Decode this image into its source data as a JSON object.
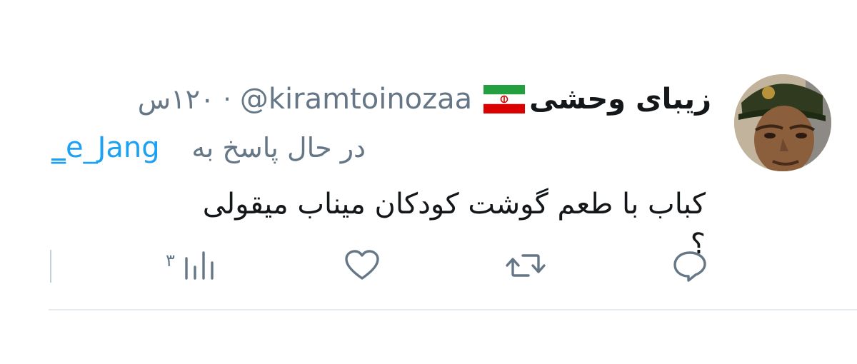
{
  "tweet": {
    "display_name": "زیبای وحشی",
    "flag": "iran-flag-icon",
    "handle": "@kiramtoinozaa",
    "separator": "·",
    "timestamp": "۱۲۰س",
    "reply_label": "در حال پاسخ به",
    "reply_to": "e_Jang",
    "reply_to_prefix": "_",
    "text_lines": [
      "کباب با طعم گوشت کودکان میناب میقولی",
      "؟"
    ]
  },
  "actions": {
    "views_count": "۳",
    "icons": [
      "reply-icon",
      "retweet-icon",
      "like-icon",
      "views-icon"
    ]
  },
  "colors": {
    "text": "#14171a",
    "secondary": "#657786",
    "link": "#1da1f2",
    "divider": "#e6ecf0",
    "flag_green": "#239f40",
    "flag_red": "#da0000"
  }
}
